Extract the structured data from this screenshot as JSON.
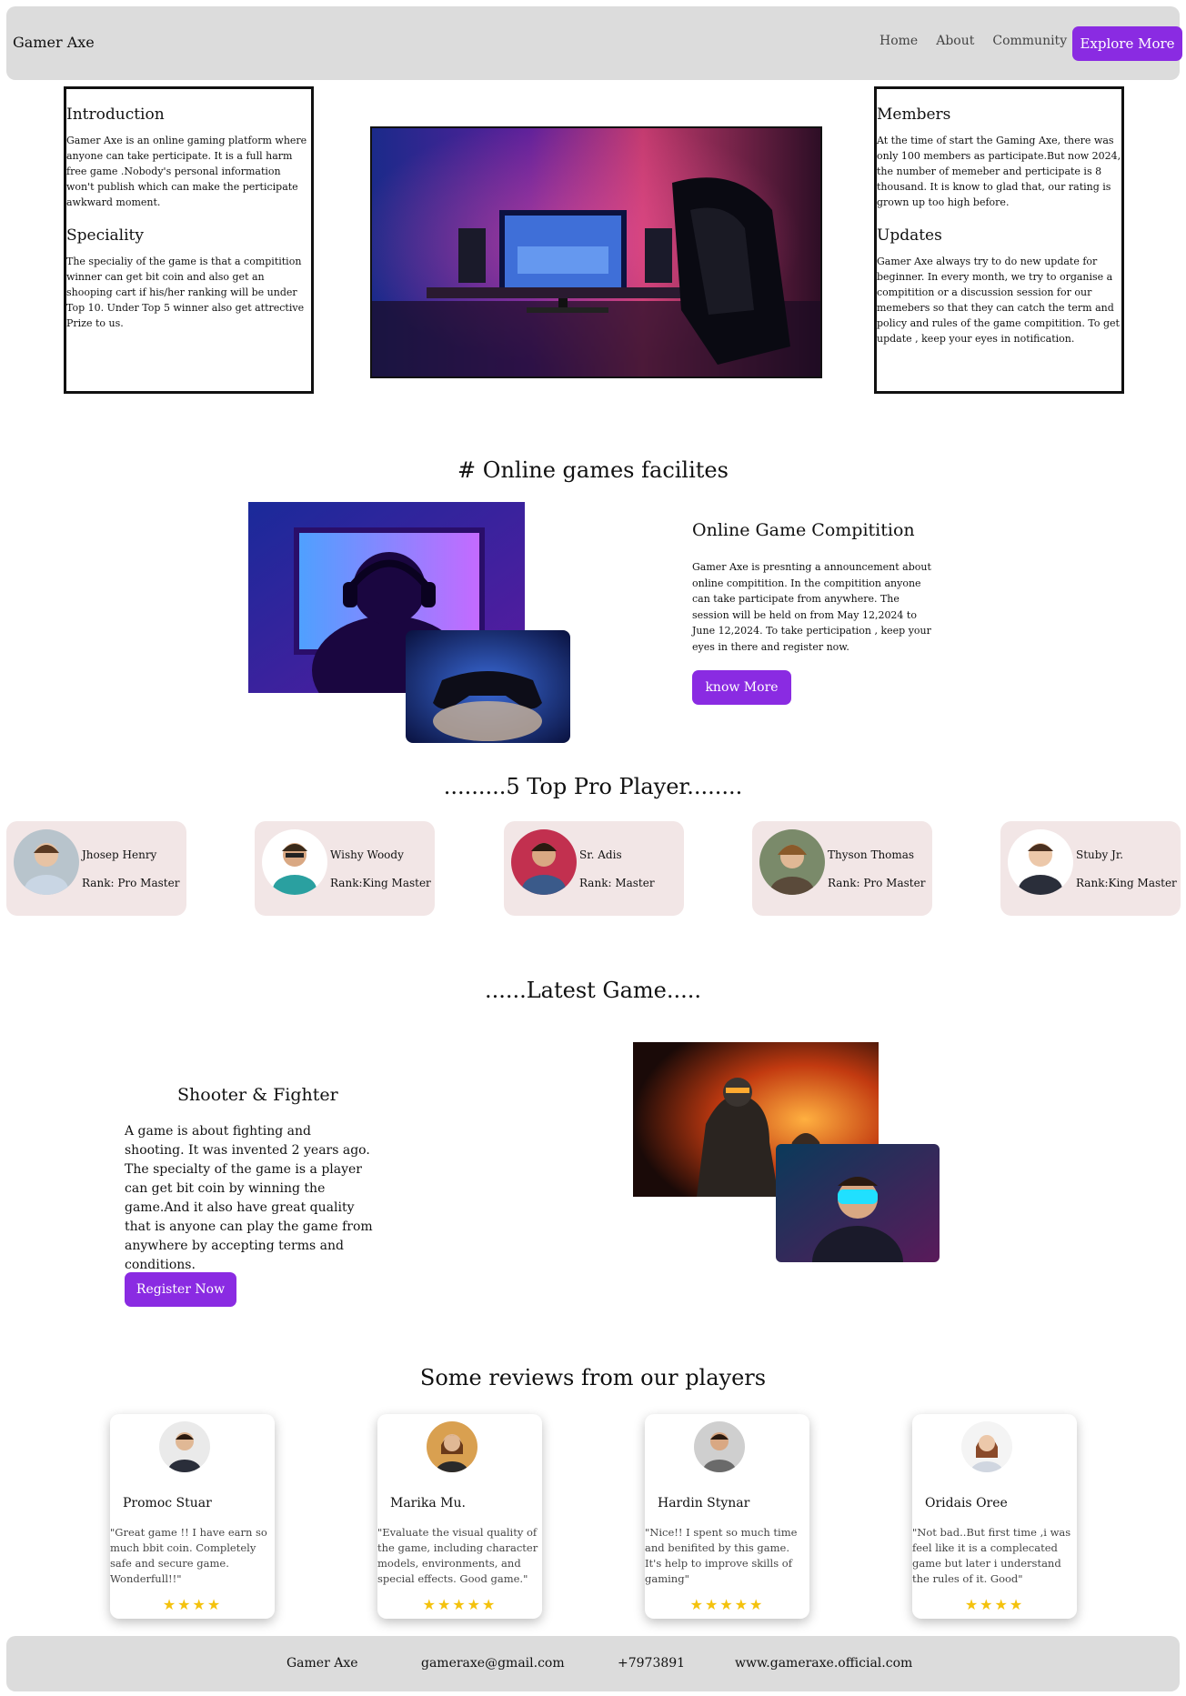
{
  "nav": {
    "brand": "Gamer Axe",
    "links": [
      "Home",
      "About",
      "Community"
    ],
    "cta": "Explore More"
  },
  "intro": {
    "title": "Introduction",
    "text": "Gamer Axe is an online gaming platform where anyone can take perticipate. It is a full harm free game .Nobody's personal information won't publish which can make the perticipate awkward moment.",
    "speciality_title": "Speciality",
    "speciality_text": "The specialiy of the game is that a compitition winner can get bit coin and also get an shooping cart if his/her ranking will be under Top 10. Under Top 5 winner also get attrective Prize to us."
  },
  "members": {
    "title": "Members",
    "text": "At the time of start the Gaming Axe, there was only 100 members as participate.But now 2024, the number of memeber and perticipate is 8 thousand. It is know to glad that, our rating is grown up too high before.",
    "updates_title": "Updates",
    "updates_text": "Gamer Axe always try to do new update for beginner. In every month, we try to organise a compitition or a discussion session for our memebers so that they can catch the term and policy and rules of the game compitition. To get update , keep your eyes in notification."
  },
  "facilities": {
    "section_title": "# Online games facilites",
    "title": "Online Game Compitition",
    "text": "Gamer Axe is presnting a announcement about online compitition. In the compitition anyone can take participate from anywhere. The session will be held on from May 12,2024 to June 12,2024. To take perticipation , keep your eyes in there and register now.",
    "button": "know More"
  },
  "players": {
    "section_title": ".........5 Top Pro Player........",
    "items": [
      {
        "name": "Jhosep Henry",
        "rank": "Rank: Pro Master",
        "color": "#b8c4cc"
      },
      {
        "name": "Wishy Woody",
        "rank": "Rank:King Master",
        "color": "#d9c2a3"
      },
      {
        "name": "Sr. Adis",
        "rank": "Rank: Master",
        "color": "#c2304f"
      },
      {
        "name": "Thyson Thomas",
        "rank": "Rank: Pro Master",
        "color": "#7a8a6a"
      },
      {
        "name": "Stuby Jr.",
        "rank": "Rank:King Master",
        "color": "#e8e8e8"
      }
    ]
  },
  "latest": {
    "section_title": "......Latest Game.....",
    "title": "Shooter & Fighter",
    "text": "A game is about fighting and shooting. It was invented 2 years ago. The specialty of the game is a player can get bit coin by winning the game.And it also have great quality that is anyone can play the game from anywhere by accepting terms and conditions.",
    "button": "Register Now"
  },
  "reviews": {
    "section_title": "Some reviews from our players",
    "items": [
      {
        "name": "Promoc Stuar",
        "text": "\"Great game !! I have earn so much bbit coin. Completely safe and secure game. Wonderfull!!\"",
        "stars": "★★★★"
      },
      {
        "name": "Marika Mu.",
        "text": "\"Evaluate the visual quality of the game, including character models, environments, and special effects. Good game.\"",
        "stars": "★★★★★"
      },
      {
        "name": "Hardin Stynar",
        "text": "\"Nice!! I spent so much time and benifited by this game. It's help to improve skills of gaming\"",
        "stars": "★★★★★"
      },
      {
        "name": "Oridais Oree",
        "text": "\"Not bad..But first time ,i was feel like it is a complecated game but later i understand the rules of it. Good\"",
        "stars": "★★★★"
      }
    ]
  },
  "footer": {
    "brand": "Gamer Axe",
    "email": "gameraxe@gmail.com",
    "phone": "+7973891",
    "website": "www.gameraxe.official.com"
  }
}
